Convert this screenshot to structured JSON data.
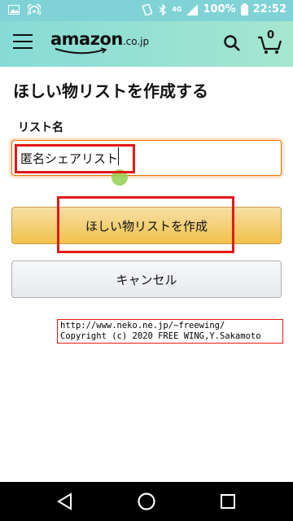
{
  "status_bar": {
    "network_label": "4G",
    "battery": "100%",
    "time": "22:52",
    "icons": [
      "image-icon",
      "hotspot-icon",
      "vibrate-icon",
      "bluetooth-icon",
      "signal-icon",
      "battery-icon"
    ]
  },
  "header": {
    "logo_text": "amazon",
    "logo_suffix": ".co.jp",
    "cart_count": "0",
    "icons": [
      "menu-icon",
      "search-icon",
      "cart-icon"
    ]
  },
  "form": {
    "title": "ほしい物リストを作成する",
    "name_label": "リスト名",
    "name_value": "匿名シェアリスト",
    "create_label": "ほしい物リストを作成",
    "cancel_label": "キャンセル"
  },
  "watermark": {
    "line1": "http://www.neko.ne.jp/~freewing/",
    "line2": "Copyright (c) 2020 FREE WING,Y.Sakamoto"
  },
  "nav_bar": {
    "icons": [
      "back-icon",
      "home-icon",
      "recents-icon"
    ]
  },
  "colors": {
    "header_start": "#86dbd6",
    "header_end": "#a6e6cf",
    "status_bar": "#7fd3d6",
    "create_button": "#f0c14b",
    "highlight": "#e41818"
  }
}
